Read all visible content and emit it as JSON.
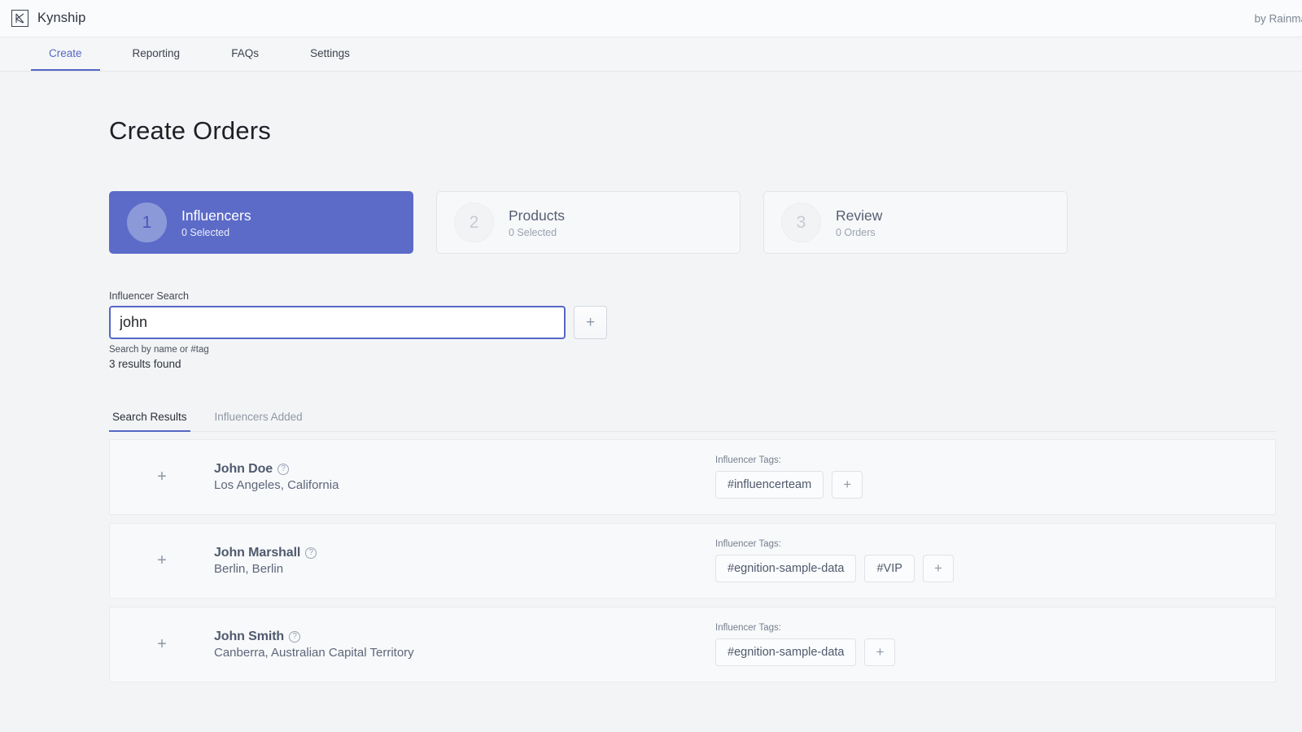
{
  "header": {
    "logo_icon": "kynship-k-logo-icon",
    "brand": "Kynship",
    "by_line": "by Rainma"
  },
  "nav": {
    "tabs": [
      {
        "label": "Create",
        "active": true
      },
      {
        "label": "Reporting",
        "active": false
      },
      {
        "label": "FAQs",
        "active": false
      },
      {
        "label": "Settings",
        "active": false
      }
    ]
  },
  "page": {
    "title": "Create Orders"
  },
  "steps": [
    {
      "num": "1",
      "label": "Influencers",
      "sub": "0 Selected",
      "active": true
    },
    {
      "num": "2",
      "label": "Products",
      "sub": "0 Selected",
      "active": false
    },
    {
      "num": "3",
      "label": "Review",
      "sub": "0 Orders",
      "active": false
    }
  ],
  "search": {
    "label": "Influencer Search",
    "value": "john",
    "placeholder": "",
    "add_button_icon": "plus-icon",
    "hint": "Search by name or #tag",
    "results_count": "3 results found"
  },
  "result_tabs": [
    {
      "label": "Search Results",
      "active": true
    },
    {
      "label": "Influencers Added",
      "active": false
    }
  ],
  "tags_label": "Influencer Tags:",
  "add_tag_icon": "plus-icon",
  "add_influencer_icon": "plus-icon",
  "help_icon_glyph": "?",
  "results": [
    {
      "name": "John Doe",
      "location": "Los Angeles, California",
      "tags": [
        "#influencerteam"
      ]
    },
    {
      "name": "John Marshall",
      "location": "Berlin, Berlin",
      "tags": [
        "#egnition-sample-data",
        "#VIP"
      ]
    },
    {
      "name": "John Smith",
      "location": "Canberra, Australian Capital Territory",
      "tags": [
        "#egnition-sample-data"
      ]
    }
  ],
  "colors": {
    "accent": "#5567c4",
    "active_card": "#5c6bc8",
    "active_circle": "#8c99d9",
    "page_bg": "#f3f4f6"
  }
}
